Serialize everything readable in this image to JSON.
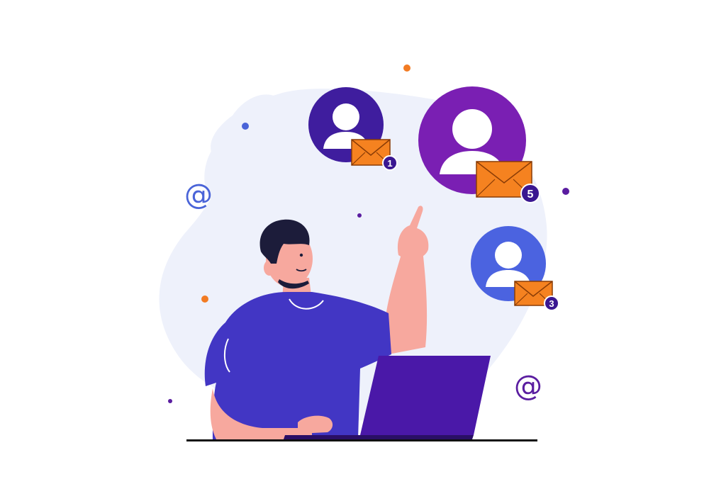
{
  "contacts": [
    {
      "id": "contact-1",
      "badge": "1",
      "color": "#3f1d9e"
    },
    {
      "id": "contact-2",
      "badge": "5",
      "color": "#7a1fb3"
    },
    {
      "id": "contact-3",
      "badge": "3",
      "color": "#4b63e0"
    }
  ],
  "at_symbol": "@",
  "colors": {
    "blob": "#eef1fb",
    "shirt": "#4236c4",
    "skin": "#f7a89e",
    "hair": "#1c1c3a",
    "laptop": "#4a18a8",
    "envelope": "#f58220",
    "envelope_line": "#8a3c06",
    "badge": "#3a1791",
    "desk": "#111111",
    "dot_orange": "#f27b23",
    "dot_blue": "#4a64d8",
    "dot_purple": "#5a1da0"
  },
  "icons": [
    "user-avatar-icon",
    "envelope-icon",
    "at-sign-icon",
    "laptop-icon"
  ]
}
